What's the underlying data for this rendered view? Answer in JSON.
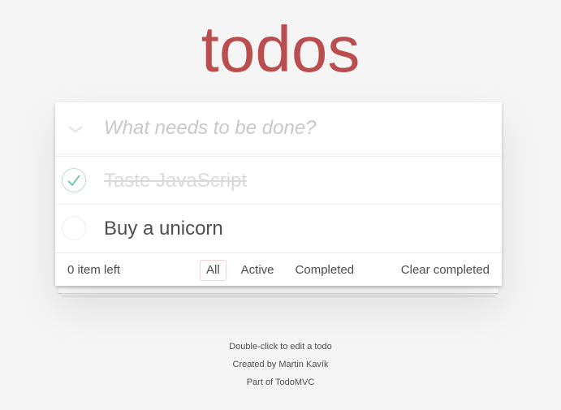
{
  "app": {
    "title": "todos"
  },
  "new_todo": {
    "placeholder": "What needs to be done?",
    "value": ""
  },
  "toggle_all": {
    "icon": "chevron-down-icon"
  },
  "todos": [
    {
      "label": "Taste JavaScript",
      "completed": true
    },
    {
      "label": "Buy a unicorn",
      "completed": false
    }
  ],
  "footer": {
    "count_text": "0 item left",
    "filters": [
      {
        "label": "All",
        "selected": true
      },
      {
        "label": "Active",
        "selected": false
      },
      {
        "label": "Completed",
        "selected": false
      }
    ],
    "clear_label": "Clear completed"
  },
  "info": {
    "line1": "Double-click to edit a todo",
    "line2": "Created by Martin Kavík",
    "line3": "Part of TodoMVC"
  },
  "colors": {
    "title": "#b83f45",
    "background": "#f5f5f5",
    "check": "#5dc2af",
    "completed_text": "#d9d9d9"
  }
}
